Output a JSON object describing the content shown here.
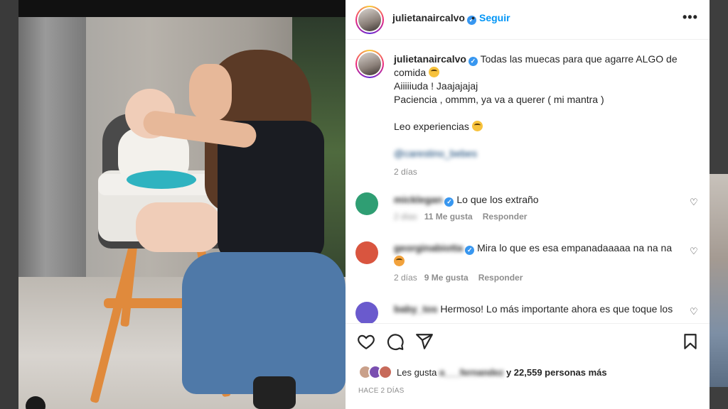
{
  "header": {
    "username": "julietanaircalvo",
    "separator": "•",
    "follow_label": "Seguir",
    "more_label": "•••"
  },
  "caption": {
    "username": "julietanaircalvo",
    "line1": "Todas las muecas para que agarre ALGO de comida",
    "line2": "Aiiiiiuda ! Jaajajajaj",
    "line3": "Paciencia , ommm, ya va a querer ( mi mantra )",
    "line4": "Leo experiencias",
    "mention": "@carestino_bebes",
    "time": "2 días"
  },
  "comments": [
    {
      "username": "micklegan",
      "text": "Lo que los extraño",
      "time": "2 días",
      "likes": "11 Me gusta",
      "reply": "Responder",
      "verified": true,
      "avatar_color": "#2f9e73"
    },
    {
      "username": "georginabiotta",
      "text": "Mira lo que es esa empanadaaaaa na na na",
      "time": "2 días",
      "likes": "9 Me gusta",
      "reply": "Responder",
      "verified": true,
      "avatar_color": "#d9553f"
    },
    {
      "username": "baby_tos",
      "text": "Hermoso! Lo más importante ahora es que toque los",
      "verified": false,
      "avatar_color": "#6a5acd"
    }
  ],
  "actions": {
    "like_icon": "heart-icon",
    "comment_icon": "comment-icon",
    "share_icon": "share-icon",
    "save_icon": "bookmark-icon"
  },
  "likes": {
    "prefix": "Les gusta",
    "user": "a___fernandez",
    "suffix": "y 22,559 personas más"
  },
  "posted": "HACE 2 DÍAS",
  "colors": {
    "accent": "#0095f6",
    "verified": "#3897f0",
    "meta": "#8e8e8e"
  }
}
